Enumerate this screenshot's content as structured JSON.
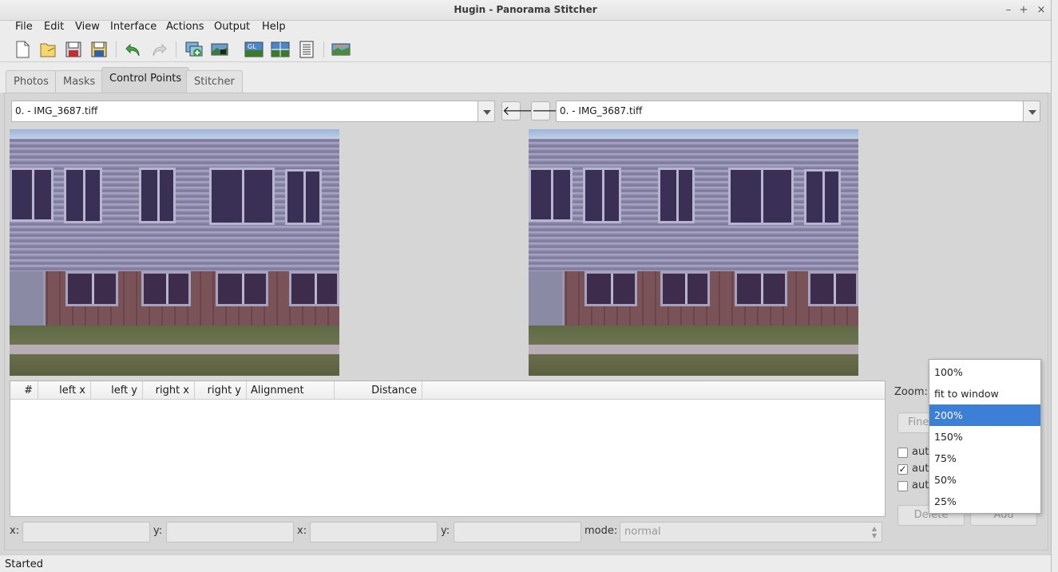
{
  "window": {
    "title": "Hugin - Panorama Stitcher",
    "minimize": "–",
    "maximize": "+",
    "close": "×"
  },
  "menu": [
    "File",
    "Edit",
    "View",
    "Interface",
    "Actions",
    "Output",
    "Help"
  ],
  "toolbar": {
    "icons": [
      "new-project-icon",
      "open-project-icon",
      "save-icon",
      "save-as-icon",
      "undo-icon",
      "redo-icon",
      "add-images-icon",
      "assistant-icon",
      "gl-preview-icon",
      "fast-preview-icon",
      "optimizer-icon",
      "preview-panorama-icon"
    ],
    "gl_label": "GL"
  },
  "tabs": [
    {
      "label": "Photos",
      "active": false
    },
    {
      "label": "Masks",
      "active": false
    },
    {
      "label": "Control Points",
      "active": true
    },
    {
      "label": "Stitcher",
      "active": false
    }
  ],
  "left_image": {
    "selected": "0. - IMG_3687.tiff"
  },
  "right_image": {
    "selected": "0. - IMG_3687.tiff"
  },
  "nav": {
    "prev": "🡐",
    "next": "🡒"
  },
  "table": {
    "columns": [
      "#",
      "left x",
      "left y",
      "right x",
      "right y",
      "Alignment",
      "Distance"
    ],
    "rows": []
  },
  "fields": {
    "x_left_label": "x:",
    "y_left_label": "y:",
    "x_right_label": "x:",
    "y_right_label": "y:",
    "mode_label": "mode:",
    "mode_value": "normal"
  },
  "zoom": {
    "label": "Zoom:",
    "options": [
      "100%",
      "fit to window",
      "200%",
      "150%",
      "75%",
      "50%",
      "25%"
    ],
    "selected": "200%"
  },
  "side": {
    "fine_tune": "Fine",
    "check1_label": "auto",
    "check2_label": "auto",
    "check3_label": "auto",
    "check1": false,
    "check2": true,
    "check3": false,
    "delete": "Delete",
    "add": "Add"
  },
  "status": {
    "text": "Started"
  }
}
